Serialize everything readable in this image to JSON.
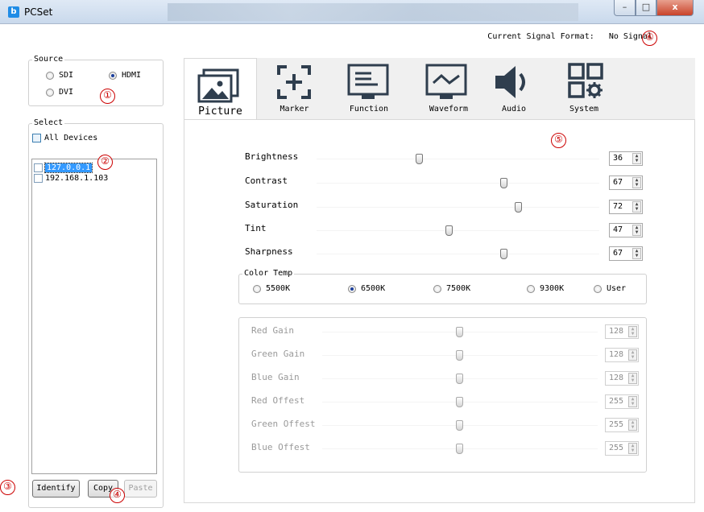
{
  "window": {
    "title": "PCSet",
    "app_icon": "b",
    "min": "–",
    "max": "□",
    "close": "x"
  },
  "signal": {
    "label": "Current Signal Format:",
    "value": "No Signal"
  },
  "annotations": [
    "①",
    "②",
    "③",
    "④",
    "⑤",
    "⑥"
  ],
  "source": {
    "legend": "Source",
    "options": [
      {
        "label": "SDI",
        "selected": false
      },
      {
        "label": "HDMI",
        "selected": true
      },
      {
        "label": "DVI",
        "selected": false
      }
    ]
  },
  "select": {
    "legend": "Select",
    "all_devices": "All Devices",
    "devices": [
      "127.0.0.1",
      "192.168.1.103"
    ],
    "selected_device": "127.0.0.1"
  },
  "buttons": {
    "identify": "Identify",
    "copy": "Copy",
    "paste": "Paste"
  },
  "tabs": [
    {
      "label": "Picture",
      "icon": "picture-icon",
      "active": true
    },
    {
      "label": "Marker",
      "icon": "marker-icon",
      "active": false
    },
    {
      "label": "Function",
      "icon": "function-icon",
      "active": false
    },
    {
      "label": "Waveform",
      "icon": "waveform-icon",
      "active": false
    },
    {
      "label": "Audio",
      "icon": "audio-icon",
      "active": false
    },
    {
      "label": "System",
      "icon": "system-icon",
      "active": false
    }
  ],
  "picture": {
    "sliders": [
      {
        "label": "Brightness",
        "value": "36",
        "level": 0.36
      },
      {
        "label": "Contrast",
        "value": "67",
        "level": 0.67
      },
      {
        "label": "Saturation",
        "value": "72",
        "level": 0.72
      },
      {
        "label": "Tint",
        "value": "47",
        "level": 0.47
      },
      {
        "label": "Sharpness",
        "value": "67",
        "level": 0.67
      }
    ],
    "color_temp": {
      "legend": "Color Temp",
      "options": [
        {
          "label": "5500K",
          "selected": false
        },
        {
          "label": "6500K",
          "selected": true
        },
        {
          "label": "7500K",
          "selected": false
        },
        {
          "label": "9300K",
          "selected": false
        },
        {
          "label": "User",
          "selected": false
        }
      ]
    },
    "gain_sliders": [
      {
        "label": "Red Gain",
        "value": "128",
        "level": 0.5
      },
      {
        "label": "Green Gain",
        "value": "128",
        "level": 0.5
      },
      {
        "label": "Blue Gain",
        "value": "128",
        "level": 0.5
      },
      {
        "label": "Red Offest",
        "value": "255",
        "level": 0.5
      },
      {
        "label": "Green Offest",
        "value": "255",
        "level": 0.5
      },
      {
        "label": "Blue Offest",
        "value": "255",
        "level": 0.5
      }
    ]
  },
  "colors": {
    "annotation": "#cc0000",
    "selection": "#3399ff",
    "icon": "#2f3e4e"
  }
}
